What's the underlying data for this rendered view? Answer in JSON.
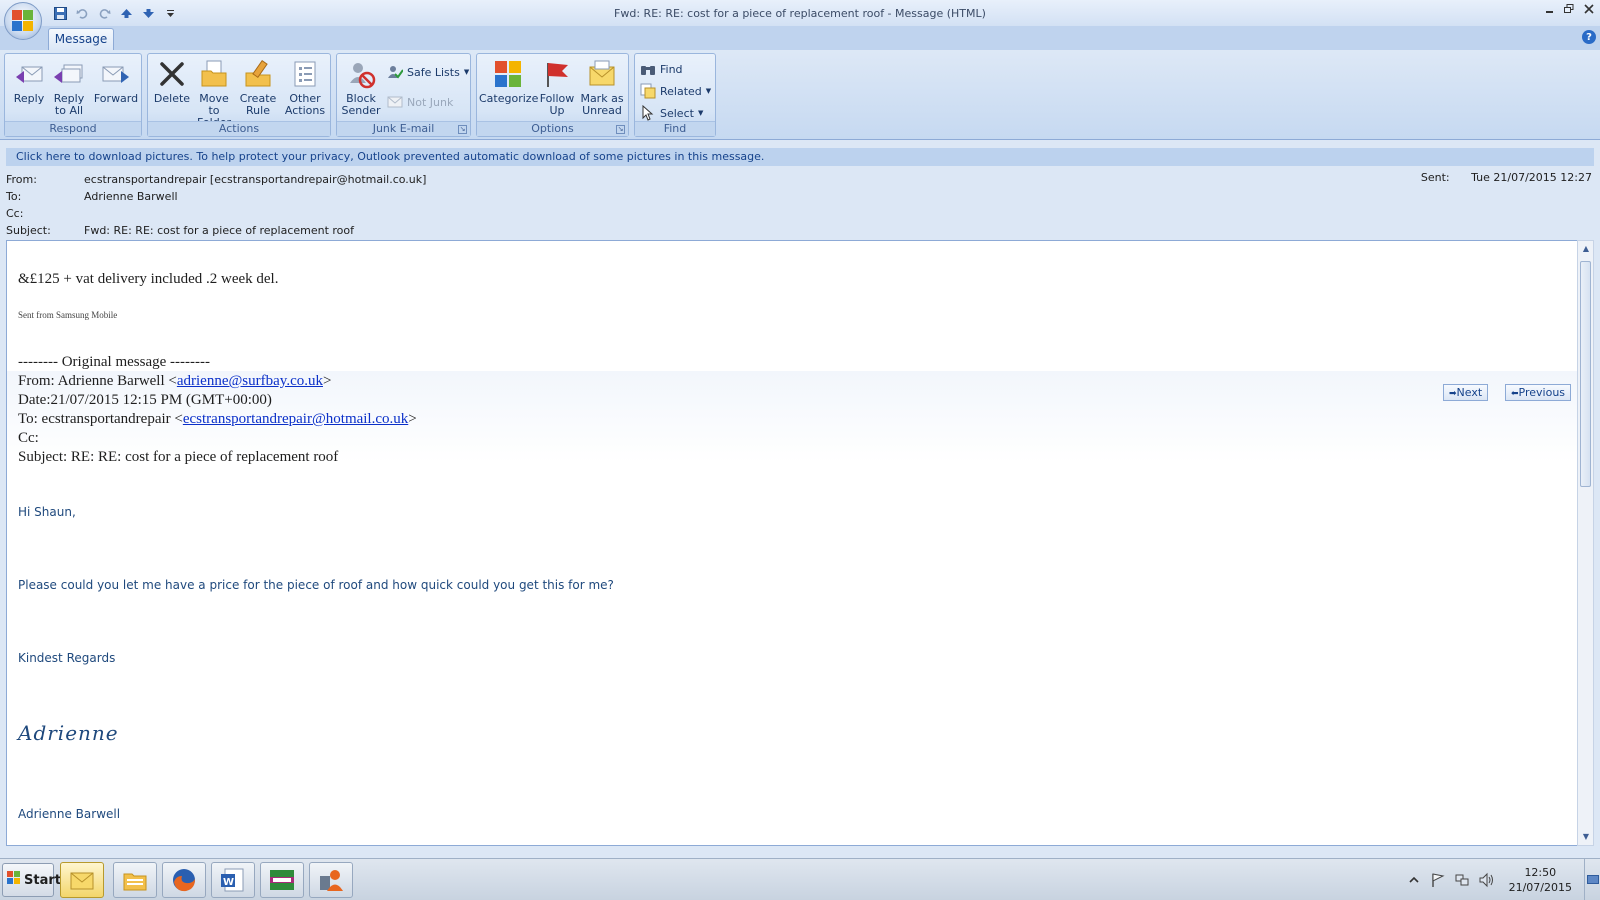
{
  "window": {
    "title": "Fwd: RE: RE: cost for a piece of replacement roof - Message (HTML)",
    "help": "?"
  },
  "ribbon": {
    "tab": "Message",
    "groups": {
      "respond": {
        "label": "Respond",
        "reply": "Reply",
        "reply_all_1": "Reply",
        "reply_all_2": "to All",
        "forward": "Forward"
      },
      "actions": {
        "label": "Actions",
        "delete": "Delete",
        "move_1": "Move to",
        "move_2": "Folder",
        "create_1": "Create",
        "create_2": "Rule",
        "other_1": "Other",
        "other_2": "Actions"
      },
      "junk": {
        "label": "Junk E-mail",
        "block_1": "Block",
        "block_2": "Sender",
        "safe_lists": "Safe Lists",
        "not_junk": "Not Junk"
      },
      "options": {
        "label": "Options",
        "categorize": "Categorize",
        "follow_1": "Follow",
        "follow_2": "Up",
        "mark_1": "Mark as",
        "mark_2": "Unread"
      },
      "find": {
        "label": "Find",
        "find": "Find",
        "related": "Related",
        "select": "Select"
      }
    }
  },
  "infobar": "Click here to download pictures. To help protect your privacy, Outlook prevented automatic download of some pictures in this message.",
  "header": {
    "from_label": "From:",
    "from_value": "ecstransportandrepair [ecstransportandrepair@hotmail.co.uk]",
    "to_label": "To:",
    "to_value": "Adrienne Barwell",
    "cc_label": "Cc:",
    "subject_label": "Subject:",
    "subject_value": "Fwd: RE: RE: cost for a piece of replacement roof",
    "sent_label": "Sent:",
    "sent_value": "Tue 21/07/2015 12:27"
  },
  "body": {
    "price_line": "&£125 +  vat delivery included .2 week del.",
    "sent_from": "Sent from Samsung Mobile",
    "original_header": "-------- Original message --------",
    "orig_from_prefix": "From: Adrienne Barwell <",
    "orig_from_email": "adrienne@surfbay.co.uk",
    "orig_from_suffix": ">",
    "orig_date": "Date:21/07/2015 12:15 PM (GMT+00:00)",
    "orig_to_prefix": "To: ecstransportandrepair <",
    "orig_to_email": "ecstransportandrepair@hotmail.co.uk",
    "orig_to_suffix": ">",
    "orig_cc": "Cc:",
    "orig_subject": "Subject: RE: RE: cost for a piece of replacement roof",
    "next": "Next",
    "previous": "Previous",
    "greeting": "Hi Shaun,",
    "request": "Please could you let me have a price for the piece of roof and how quick could you get this for me?",
    "regards": "Kindest Regards",
    "signature": "Adrienne",
    "full_name": "Adrienne Barwell"
  },
  "taskbar": {
    "start": "Start",
    "time": "12:50",
    "date": "21/07/2015"
  }
}
